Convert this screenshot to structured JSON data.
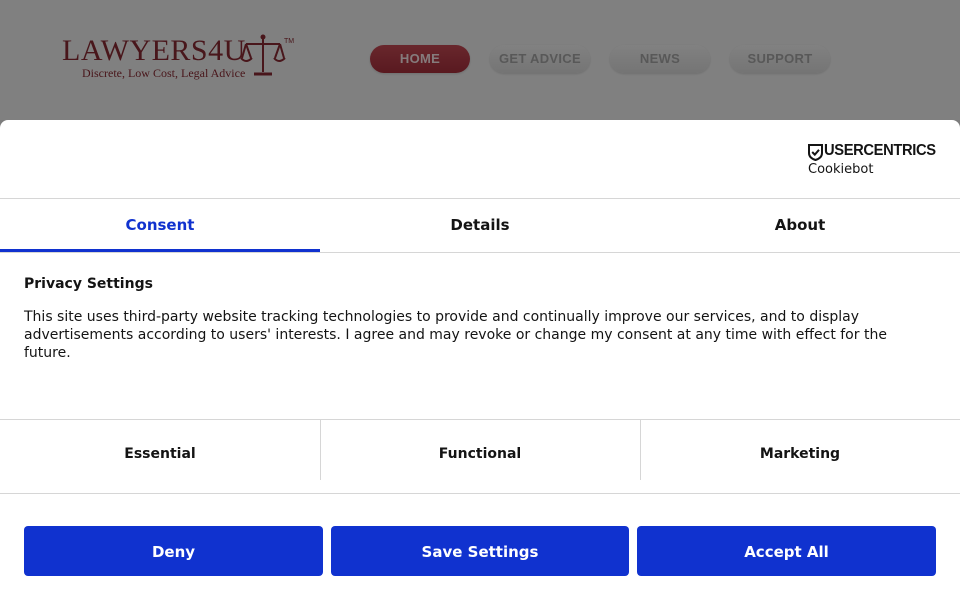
{
  "site": {
    "logo": {
      "name": "LAWYERS4U",
      "tagline": "Discrete, Low Cost, Legal Advice",
      "trademark": "TM"
    },
    "nav": [
      {
        "label": "HOME",
        "active": true
      },
      {
        "label": "GET ADVICE",
        "active": false
      },
      {
        "label": "NEWS",
        "active": false
      },
      {
        "label": "SUPPORT",
        "active": false
      }
    ],
    "colors": {
      "brand": "#8a2b33",
      "nav_active": "#b3343f"
    }
  },
  "dialog": {
    "brand": {
      "name": "USERCENTRICS",
      "product": "Cookiebot",
      "icon": "shield-check-icon"
    },
    "tabs": [
      {
        "label": "Consent",
        "active": true
      },
      {
        "label": "Details",
        "active": false
      },
      {
        "label": "About",
        "active": false
      }
    ],
    "section_title": "Privacy Settings",
    "body": "This site uses third-party website tracking technologies to provide and continually improve our services, and to display advertisements according to users' interests. I agree and may revoke or change my consent at any time with effect for the future.",
    "categories": [
      {
        "label": "Essential"
      },
      {
        "label": "Functional"
      },
      {
        "label": "Marketing"
      }
    ],
    "buttons": {
      "deny": "Deny",
      "save": "Save Settings",
      "accept": "Accept All"
    },
    "colors": {
      "accent": "#1032cf",
      "text": "#141414",
      "divider": "#d6d6d6"
    }
  }
}
